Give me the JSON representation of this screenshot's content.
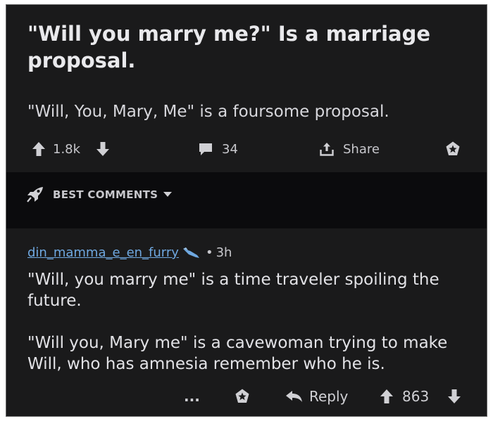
{
  "post": {
    "title": "\"Will you marry me?\" Is a marriage proposal.",
    "body": "\"Will, You, Mary, Me\" is a foursome proposal.",
    "votes": "1.8k",
    "comments_count": "34",
    "share_label": "Share"
  },
  "sort": {
    "label": "BEST COMMENTS"
  },
  "comment": {
    "username": "din_mamma_e_en_furry",
    "time": "3h",
    "paragraph1": "\"Will, you marry me\" is a time traveler spoiling the future.",
    "paragraph2": "\"Will you, Mary me\" is a cavewoman trying to make Will, who has amnesia remember who he is.",
    "more": "...",
    "reply_label": "Reply",
    "votes": "863"
  },
  "colors": {
    "background": "#1a1a1b",
    "band": "#0b0b0d",
    "text": "#e2e2e6",
    "username": "#6fa8e0",
    "badge": "#6fa8e0"
  }
}
